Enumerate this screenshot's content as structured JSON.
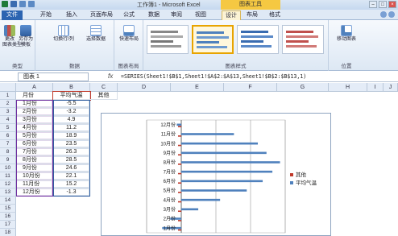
{
  "titlebar": {
    "title": "工作簿1 - Microsoft Excel",
    "chart_tools": "图表工具"
  },
  "tabs": [
    "文件",
    "开始",
    "插入",
    "页面布局",
    "公式",
    "数据",
    "审阅",
    "视图",
    "设计",
    "布局",
    "格式"
  ],
  "ribbon": {
    "groups": [
      {
        "label": "类型",
        "buttons": [
          "更改\n图表类型",
          "另存为\n模板"
        ]
      },
      {
        "label": "数据",
        "buttons": [
          "切换行/列",
          "选择数据"
        ]
      },
      {
        "label": "图表布局",
        "buttons": [
          "快速布局"
        ]
      },
      {
        "label": "图表样式",
        "buttons": []
      },
      {
        "label": "位置",
        "buttons": [
          "移动图表"
        ]
      }
    ]
  },
  "formula_bar": {
    "name_box": "图表 1",
    "fx": "fx",
    "formula": "=SERIES(Sheet1!$B$1,Sheet1!$A$2:$A$13,Sheet1!$B$2:$B$13,1)"
  },
  "columns": [
    "A",
    "B",
    "C",
    "D",
    "E",
    "F",
    "G",
    "H",
    "I",
    "J",
    "K"
  ],
  "rows": [
    "1",
    "2",
    "3",
    "4",
    "5",
    "6",
    "7",
    "8",
    "9",
    "10",
    "11",
    "12",
    "13",
    "14",
    "15",
    "16",
    "17",
    "18"
  ],
  "sheet": {
    "headers": [
      "月份",
      "平均气温",
      "其他"
    ],
    "data": [
      [
        "1月份",
        "-5.5"
      ],
      [
        "2月份",
        "-3.2"
      ],
      [
        "3月份",
        "4.9"
      ],
      [
        "4月份",
        "11.2"
      ],
      [
        "5月份",
        "18.9"
      ],
      [
        "6月份",
        "23.5"
      ],
      [
        "7月份",
        "26.3"
      ],
      [
        "8月份",
        "28.5"
      ],
      [
        "9月份",
        "24.6"
      ],
      [
        "10月份",
        "22.1"
      ],
      [
        "11月份",
        "15.2"
      ],
      [
        "12月份",
        "-1.3"
      ]
    ]
  },
  "chart_data": {
    "type": "bar",
    "orientation": "horizontal",
    "categories": [
      "1月份",
      "2月份",
      "3月份",
      "4月份",
      "5月份",
      "6月份",
      "7月份",
      "8月份",
      "9月份",
      "10月份",
      "11月份",
      "12月份"
    ],
    "series": [
      {
        "name": "其他",
        "values": [
          0,
          0,
          0,
          0,
          0,
          0,
          0,
          0,
          0,
          0,
          0,
          0
        ],
        "color": "#c0392b"
      },
      {
        "name": "平均气温",
        "values": [
          -5.5,
          -3.2,
          4.9,
          11.2,
          18.9,
          23.5,
          26.3,
          28.5,
          24.6,
          22.1,
          15.2,
          -1.3
        ],
        "color": "#4f81bd"
      }
    ],
    "legend": "right",
    "grid": true
  },
  "colors": {
    "accent": "#2c64b1",
    "chart_tools": "#f5c842",
    "series_blue": "#4f81bd",
    "series_red": "#c0392b"
  }
}
